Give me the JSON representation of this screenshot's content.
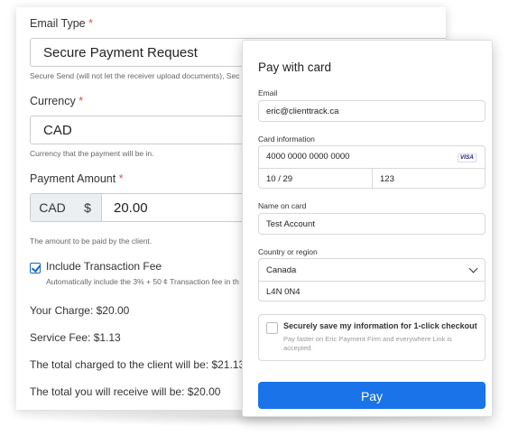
{
  "form": {
    "email_type": {
      "label": "Email Type",
      "required": "*",
      "value": "Secure Payment Request",
      "hint": "Secure Send (will not let the receiver upload documents), Sec"
    },
    "currency": {
      "label": "Currency",
      "required": "*",
      "value": "CAD",
      "hint": "Currency that the payment will be in."
    },
    "amount": {
      "label": "Payment Amount",
      "required": "*",
      "currency_addon": "CAD",
      "symbol_addon": "$",
      "value": "20.00",
      "hint": "The amount to be paid by the client."
    },
    "transaction_fee": {
      "label": "Include Transaction Fee",
      "checked": true,
      "hint": "Automatically include the 3% + 50 ¢ Transaction fee in th"
    },
    "summary": {
      "your_charge": "Your Charge: $20.00",
      "service_fee": "Service Fee: $1.13",
      "total_charged": "The total charged to the client will be: $21.13",
      "total_receive": "The total you will receive will be: $20.00"
    }
  },
  "pay_panel": {
    "title": "Pay with card",
    "email_label": "Email",
    "email_value": "eric@clienttrack.ca",
    "card_label": "Card information",
    "card_number": "4000 0000 0000 0000",
    "card_brand": "VISA",
    "expiry": "10 / 29",
    "cvc": "123",
    "name_label": "Name on card",
    "name_value": "Test Account",
    "country_label": "Country or region",
    "country_value": "Canada",
    "postal_value": "L4N 0N4",
    "save_title": "Securely save my information for 1-click checkout",
    "save_subtitle": "Pay faster on Eric Payment Firm and everywhere Link is accepted.",
    "pay_button": "Pay"
  },
  "colors": {
    "accent": "#1a73e8",
    "required": "#d9534f",
    "checkbox": "#1565c0"
  }
}
